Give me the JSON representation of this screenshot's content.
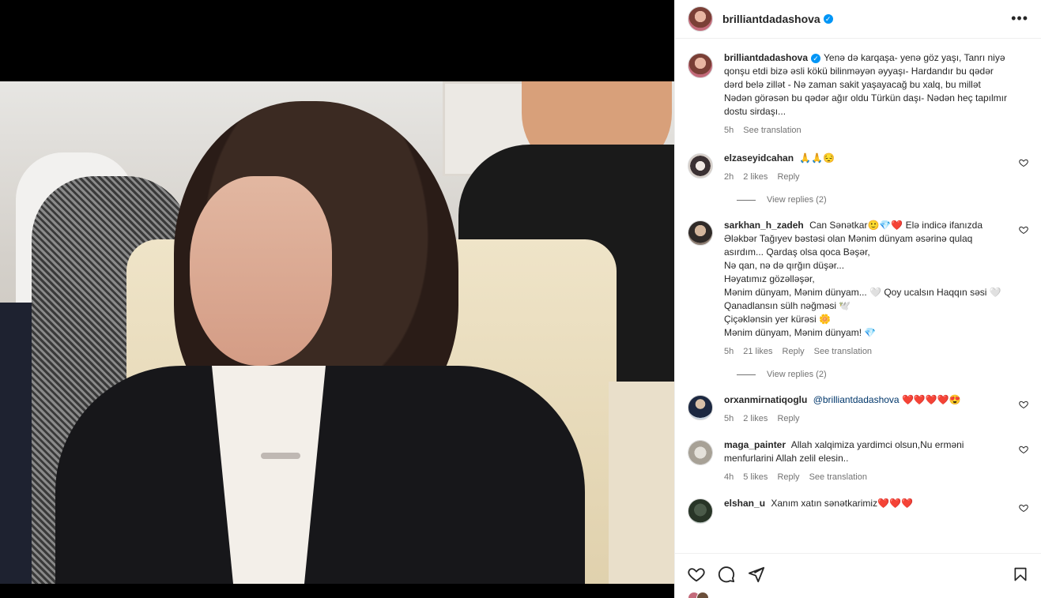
{
  "post": {
    "username": "brilliantdadashova",
    "caption": "Yenə də karqaşa- yenə göz yaşı, Tanrı niyə qonşu etdi bizə əsli kökü bilinməyən əyyaşı- Hardandır bu qədər dərd belə zillət - Nə zaman sakit yaşayacağ bu xalq, bu millət Nədən görəsən bu qədər ağır oldu Türkün daşı- Nədən heç tapılmır dostu sirdaşı...",
    "caption_time": "5h",
    "see_translation": "See translation"
  },
  "comments": [
    {
      "username": "elzaseyidcahan",
      "text": "🙏🙏😔",
      "time": "2h",
      "likes": "2 likes",
      "reply": "Reply",
      "translation": "",
      "view_replies": "View replies (2)"
    },
    {
      "username": "sarkhan_h_zadeh",
      "text": "Can Sənətkar🙂💎❤️ Elə indicə ifanızda Ələkbər Tağıyev bəstəsi olan Mənim dünyam əsərinə qulaq asırdım... Qardaş olsa qoca Bəşər,\nNə qan, nə də qırğın düşər...\nHəyatımız gözəlləşər,\nMənim dünyam, Mənim dünyam... 🤍 Qoy ucalsın Haqqın səsi 🤍\nQanadlansın sülh nəğməsi 🕊️\nÇiçəklənsin yer kürəsi 🌼\nMənim dünyam, Mənim dünyam! 💎",
      "time": "5h",
      "likes": "21 likes",
      "reply": "Reply",
      "translation": "See translation",
      "view_replies": "View replies (2)"
    },
    {
      "username": "orxanmirnatiqoglu",
      "mention": "@brilliantdadashova",
      "text": "❤️❤️❤️❤️😍",
      "time": "5h",
      "likes": "2 likes",
      "reply": "Reply",
      "translation": ""
    },
    {
      "username": "maga_painter",
      "text": "Allah xalqimiza yardimci olsun,Nu ermәni menfurlarini Allah zelil elesin..",
      "time": "4h",
      "likes": "5 likes",
      "reply": "Reply",
      "translation": "See translation"
    },
    {
      "username": "elshan_u",
      "text": "Xanım xatın sənətkarimiz❤️❤️❤️",
      "time": "",
      "likes": "",
      "reply": "",
      "translation": ""
    }
  ],
  "icons": {
    "more": "more-horizontal-icon",
    "like": "heart-icon",
    "comment": "comment-icon",
    "share": "paper-plane-icon",
    "save": "bookmark-icon",
    "verified": "verified-badge-icon"
  },
  "colors": {
    "verified": "#0095f6",
    "meta": "#737373",
    "text": "#262626",
    "background_media": "#000000"
  }
}
